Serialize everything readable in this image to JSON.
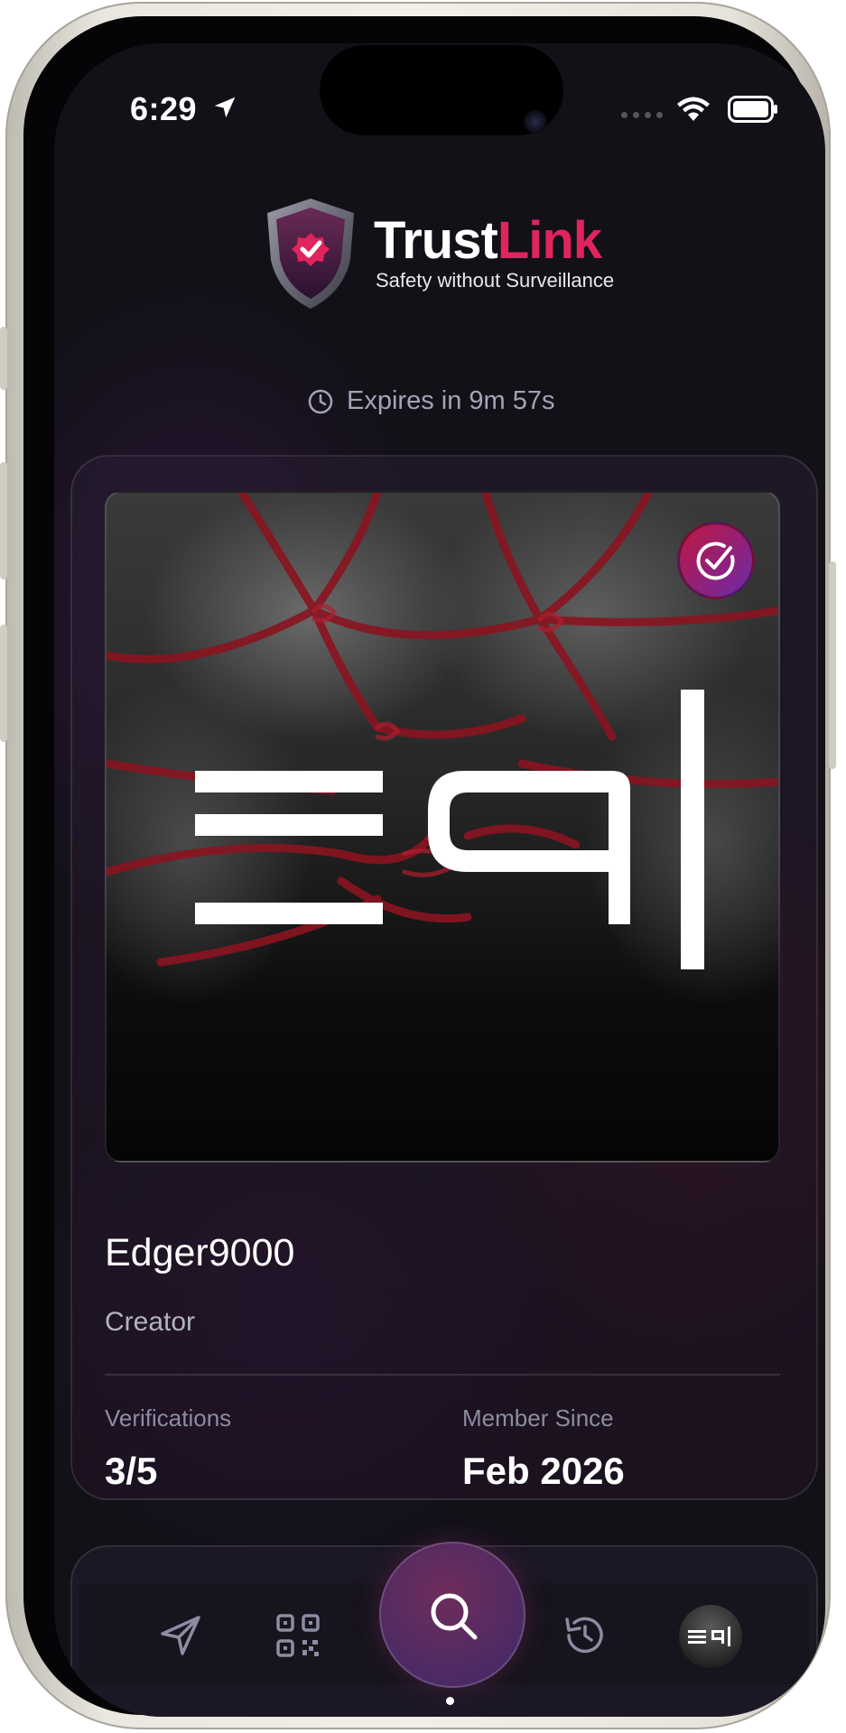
{
  "status_bar": {
    "time": "6:29",
    "location_icon": "location-arrow-icon",
    "wifi_icon": "wifi-icon",
    "battery_icon": "battery-icon"
  },
  "logo": {
    "title_main": "Trust",
    "title_accent": "Link",
    "subtitle": "Safety without Surveillance",
    "icon": "shield-check-icon"
  },
  "expires": {
    "icon": "clock-icon",
    "text": "Expires in 9m 57s"
  },
  "profile": {
    "photo_logo_text": "≡9|",
    "verified_icon": "verified-check-icon",
    "username": "Edger9000",
    "role": "Creator",
    "stats": [
      {
        "label": "Verifications",
        "value": "3/5"
      },
      {
        "label": "Member Since",
        "value": "Feb 2026"
      }
    ]
  },
  "nav": {
    "items": [
      {
        "name": "send",
        "icon": "paper-plane-icon"
      },
      {
        "name": "qr",
        "icon": "qr-code-icon"
      },
      {
        "name": "search",
        "icon": "search-icon",
        "active": true
      },
      {
        "name": "history",
        "icon": "history-icon"
      },
      {
        "name": "profile",
        "icon": "avatar"
      }
    ]
  },
  "colors": {
    "accent": "#e0245e",
    "background": "#121118",
    "badge_gradient_start": "#c0173f",
    "badge_gradient_end": "#6a2aa8"
  }
}
